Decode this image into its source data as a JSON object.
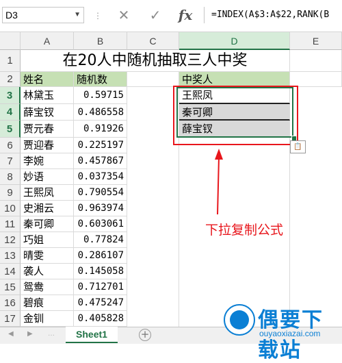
{
  "formula_bar": {
    "name_box": "D3",
    "cancel_icon": "x-icon",
    "enter_icon": "check-icon",
    "fx_label": "fx",
    "formula": "=INDEX(A$3:A$22,RANK(B"
  },
  "columns": [
    "A",
    "B",
    "C",
    "D",
    "E"
  ],
  "rows": [
    "1",
    "2",
    "3",
    "4",
    "5",
    "6",
    "7",
    "8",
    "9",
    "10",
    "11",
    "12",
    "13",
    "14",
    "15",
    "16",
    "17"
  ],
  "sheet": {
    "title": "在20人中随机抽取三人中奖",
    "header_name": "姓名",
    "header_random": "随机数",
    "header_winner": "中奖人",
    "names": [
      "林黛玉",
      "薛宝钗",
      "贾元春",
      "贾迎春",
      "李婉",
      "妙语",
      "王熙凤",
      "史湘云",
      "秦可卿",
      "巧姐",
      "晴雯",
      "袭人",
      "鸳鸯",
      "碧痕",
      "金钏"
    ],
    "randoms": [
      "0.59715",
      "0.486558",
      "0.91926",
      "0.225197",
      "0.457867",
      "0.037354",
      "0.790554",
      "0.963974",
      "0.603061",
      "0.77824",
      "0.286107",
      "0.145058",
      "0.712701",
      "0.475247",
      "0.405828"
    ],
    "winners": [
      "王熙凤",
      "秦可卿",
      "薛宝钗"
    ]
  },
  "annotation": "下拉复制公式",
  "tabs": {
    "active": "Sheet1",
    "add_icon": "plus-icon"
  },
  "watermark": {
    "brand": "偶要下载站",
    "url": "ouyaoxiazai.com"
  },
  "colors": {
    "accent": "#217346",
    "header_fill": "#c6e0b4",
    "annotation": "#e8161c",
    "brand": "#0b7fd4"
  }
}
